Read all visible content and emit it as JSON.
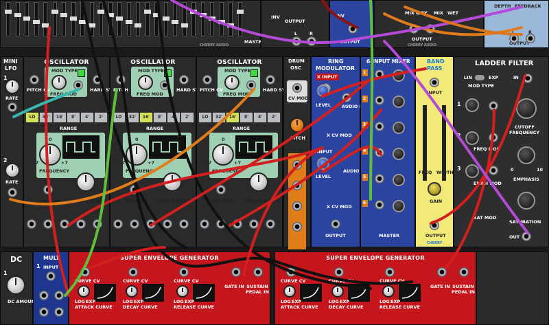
{
  "top_row": {
    "mixer_labels": {
      "inv": "INV",
      "output": "OUTPUT",
      "l": "L",
      "r": "R",
      "master": "MASTER"
    },
    "ring_labels": {
      "inv": "INV",
      "output": "OUTPUT"
    },
    "fx_labels": {
      "mix_cv": "MIX CV",
      "dry": "DRY",
      "mix": "MIX",
      "wet": "WET",
      "output": "OUTPUT",
      "l": "L",
      "r": "R"
    },
    "delay_labels": {
      "depth": "DEPTH",
      "feedback": "FEEDBACK",
      "output": "OUTPUT",
      "l": "L",
      "r": "R"
    },
    "brand": "CHERRY AUDIO"
  },
  "mini_lfo": {
    "title_1": "MINI",
    "title_2": "LFO",
    "rate": "RATE",
    "num_1": "1",
    "num_2": "2"
  },
  "oscillators": [
    {
      "title": "OSCILLATOR",
      "pitch_cv": "PITCH CV",
      "mod_type": "MOD TYPE",
      "freq_mod": "FREQ MOD",
      "hard_sync": "HARD SYNC",
      "range": "RANGE",
      "frequency": "FREQUENCY",
      "pw_mod": "PW MOD",
      "pulse_width": "PULSE WIDTH",
      "plus7": "+7",
      "minus7": "-7",
      "zero": "0",
      "ranges": [
        "LO",
        "32'",
        "16'",
        "8'",
        "4'",
        "2'"
      ],
      "active_range": 0
    },
    {
      "title": "OSCILLATOR",
      "pitch_cv": "PITCH",
      "mod_type": "MOD TYPE",
      "freq_mod": "FREQ MOD",
      "hard_sync": "HARD SYNC",
      "range": "RANGE",
      "frequency": "FREQUENCY",
      "pw_mod": "PW MOD",
      "pulse_width": "PULSE WIDTH",
      "plus7": "+7",
      "minus7": "-7",
      "zero": "0",
      "ranges": [
        "LO",
        "32'",
        "16'",
        "8'",
        "4'",
        "2'"
      ],
      "active_range": 2
    },
    {
      "title": "OSCILLATOR",
      "pitch_cv": "PITCH CV",
      "mod_type": "MOD TYPE",
      "freq_mod": "FREQ MOD",
      "hard_sync": "HARD SYNC",
      "range": "RANGE",
      "frequency": "FREQUENCY",
      "pw_mod": "PW MOD",
      "pulse_width": "PULSE WIDTH",
      "plus7": "+7",
      "minus7": "-7",
      "zero": "0",
      "ranges": [
        "LO",
        "32'",
        "16'",
        "8'",
        "4'",
        "2'"
      ],
      "active_range": 2
    }
  ],
  "drum_osc": {
    "title_1": "DRUM",
    "title_2": "OSC",
    "cv_mod": "CV MOD",
    "pitch": "PITCH"
  },
  "ring_mod": {
    "title_1": "RING",
    "title_2": "MODULATOR",
    "x_input": "X INPUT",
    "level": "LEVEL",
    "audio_in": "AUDIO IN",
    "x_cv_mod": "X CV MOD",
    "input": "INPUT",
    "audio": "AUDIO",
    "output": "OUTPUT"
  },
  "six_input_mixer": {
    "title": "6-INPUT MIXER",
    "master": "MASTER",
    "channels": [
      "1",
      "2",
      "3",
      "4",
      "5",
      "6"
    ]
  },
  "band_pass": {
    "title_1": "BAND",
    "title_2": "PASS",
    "input": "INPUT",
    "freq": "FREQ",
    "width": "WIDTH",
    "gain": "GAIN",
    "output": "OUTPUT",
    "brand": "CHERRY"
  },
  "ladder_filter": {
    "title": "LADDER FILTER",
    "lin": "LIN",
    "exp": "EXP",
    "mod_type": "MOD TYPE",
    "in": "IN",
    "cutoff_1": "CUTOFF",
    "cutoff_2": "FREQUENCY",
    "freq_mod": "FREQ MOD",
    "emph_mod": "EMPH MOD",
    "emphasis": "EMPHASIS",
    "sat_mod": "SAT MOD",
    "saturation": "SATURATION",
    "out": "OUT",
    "num_1": "1",
    "num_2": "2",
    "num_3": "3",
    "zero": "0",
    "ten": "10"
  },
  "dc": {
    "title": "DC",
    "amount": "DC AMOUNT",
    "num": "1"
  },
  "mult": {
    "title": "MULT",
    "input": "INPUT",
    "num": "1"
  },
  "envelopes": [
    {
      "title": "SUPER ENVELOPE GENERATOR",
      "curve_cv": "CURVE CV",
      "log": "LOG",
      "exp": "EXP",
      "attack_curve": "ATTACK CURVE",
      "decay_curve": "DECAY CURVE",
      "release_curve": "RELEASE CURVE",
      "gate_in": "GATE IN",
      "sustain_pedal": "SUSTAIN PEDAL IN"
    },
    {
      "title": "SUPER ENVELOPE GENERATOR",
      "curve_cv": "CURVE CV",
      "log": "LOG",
      "exp": "EXP",
      "attack_curve": "ATTACK CURVE",
      "decay_curve": "DECAY CURVE",
      "release_curve": "RELEASE CURVE",
      "gate_in": "GATE IN",
      "sustain_pedal": "SUSTAIN PEDAL IN"
    }
  ],
  "colors": {
    "osc_panel": "#9fd0b4",
    "ring_panel": "#2a44a0",
    "mixer_panel": "#2a44a0",
    "band_pass_panel": "#f2ea78",
    "ladder_panel": "#2e2e2e",
    "env_panel": "#c4161c",
    "cable_red": "#d41f1f",
    "cable_black": "#111111",
    "cable_orange": "#e07c1a",
    "cable_green": "#5fbf3d",
    "cable_purple": "#b34bd8",
    "cable_teal": "#3ab7b0"
  }
}
